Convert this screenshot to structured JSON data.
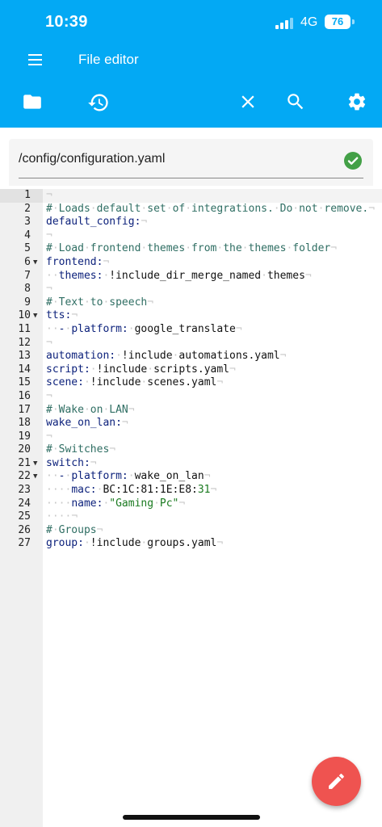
{
  "status_bar": {
    "time": "10:39",
    "network": "4G",
    "battery": "76"
  },
  "app_bar": {
    "title": "File editor"
  },
  "toolbar": {
    "icons": [
      "folder-icon",
      "history-icon",
      "close-icon",
      "search-icon",
      "settings-icon"
    ]
  },
  "path": {
    "value": "/config/configuration.yaml"
  },
  "colors": {
    "primary": "#03a9f4",
    "fab": "#ef5350",
    "valid": "#43a047"
  },
  "editor": {
    "lines": [
      {
        "n": "1",
        "fold": false,
        "code": ""
      },
      {
        "n": "2",
        "fold": false,
        "code": "# Loads default set of integrations. Do not remove."
      },
      {
        "n": "3",
        "fold": false,
        "code": "default_config:"
      },
      {
        "n": "4",
        "fold": false,
        "code": ""
      },
      {
        "n": "5",
        "fold": false,
        "code": "# Load frontend themes from the themes folder"
      },
      {
        "n": "6",
        "fold": true,
        "code": "frontend:"
      },
      {
        "n": "7",
        "fold": false,
        "code": "  themes: !include_dir_merge_named themes"
      },
      {
        "n": "8",
        "fold": false,
        "code": ""
      },
      {
        "n": "9",
        "fold": false,
        "code": "# Text to speech"
      },
      {
        "n": "10",
        "fold": true,
        "code": "tts:"
      },
      {
        "n": "11",
        "fold": false,
        "code": "  - platform: google_translate"
      },
      {
        "n": "12",
        "fold": false,
        "code": ""
      },
      {
        "n": "13",
        "fold": false,
        "code": "automation: !include automations.yaml"
      },
      {
        "n": "14",
        "fold": false,
        "code": "script: !include scripts.yaml"
      },
      {
        "n": "15",
        "fold": false,
        "code": "scene: !include scenes.yaml"
      },
      {
        "n": "16",
        "fold": false,
        "code": ""
      },
      {
        "n": "17",
        "fold": false,
        "code": "# Wake on LAN"
      },
      {
        "n": "18",
        "fold": false,
        "code": "wake_on_lan:"
      },
      {
        "n": "19",
        "fold": false,
        "code": ""
      },
      {
        "n": "20",
        "fold": false,
        "code": "# Switches"
      },
      {
        "n": "21",
        "fold": true,
        "code": "switch:"
      },
      {
        "n": "22",
        "fold": true,
        "code": "  - platform: wake_on_lan"
      },
      {
        "n": "23",
        "fold": false,
        "code": "    mac: BC:1C:81:1E:E8:31"
      },
      {
        "n": "24",
        "fold": false,
        "code": "    name: \"Gaming Pc\""
      },
      {
        "n": "25",
        "fold": false,
        "code": "    "
      },
      {
        "n": "26",
        "fold": false,
        "code": "# Groups"
      },
      {
        "n": "27",
        "fold": false,
        "code": "group: !include groups.yaml"
      }
    ]
  },
  "fab": {
    "icon": "pencil-icon"
  }
}
